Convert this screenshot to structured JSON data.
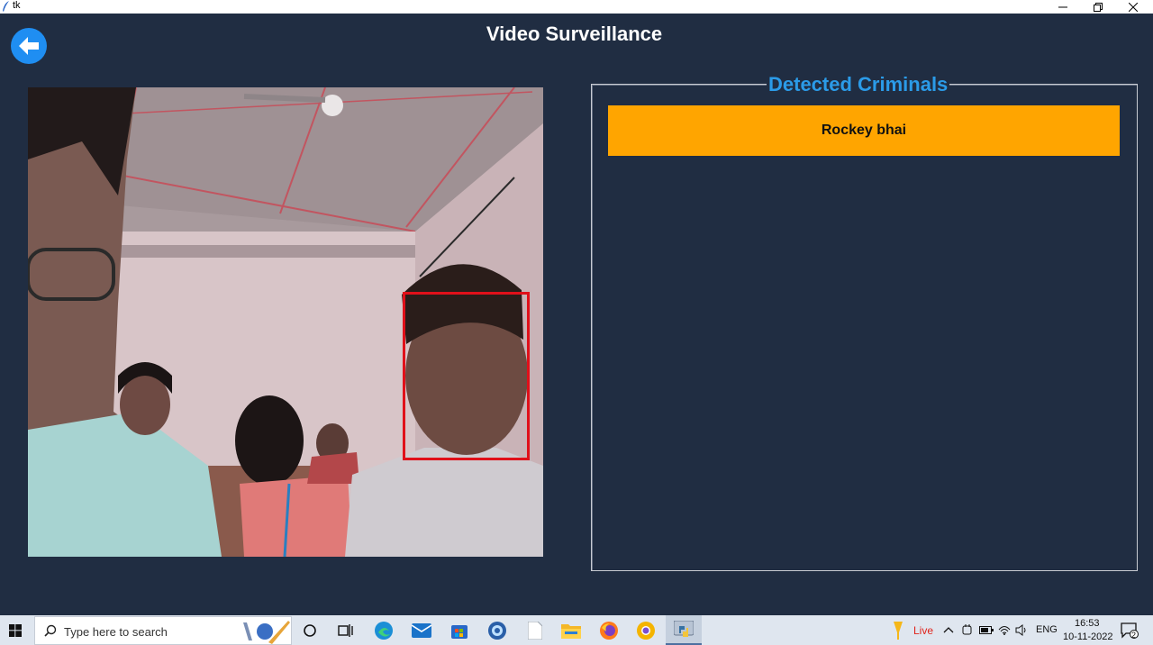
{
  "window": {
    "title": "tk"
  },
  "app": {
    "title": "Video Surveillance",
    "detected_panel": {
      "title": "Detected Criminals",
      "items": [
        {
          "name": "Rockey bhai"
        }
      ]
    },
    "colors": {
      "background": "#202d42",
      "accent": "#2b9be8",
      "item_bg": "#ffa500",
      "face_box": "#e0101a",
      "back_button": "#1f8ef2"
    }
  },
  "taskbar": {
    "search_placeholder": "Type here to search",
    "pinned": [
      "cortana-icon",
      "task-view-icon",
      "edge-icon",
      "mail-icon",
      "store-icon",
      "camera-app-icon",
      "notepad-icon",
      "file-explorer-icon",
      "firefox-icon",
      "chrome-canary-icon",
      "python-icon"
    ],
    "tray": {
      "live_label": "Live",
      "language": "ENG",
      "time": "16:53",
      "date": "10-11-2022",
      "notifications": "2"
    }
  }
}
